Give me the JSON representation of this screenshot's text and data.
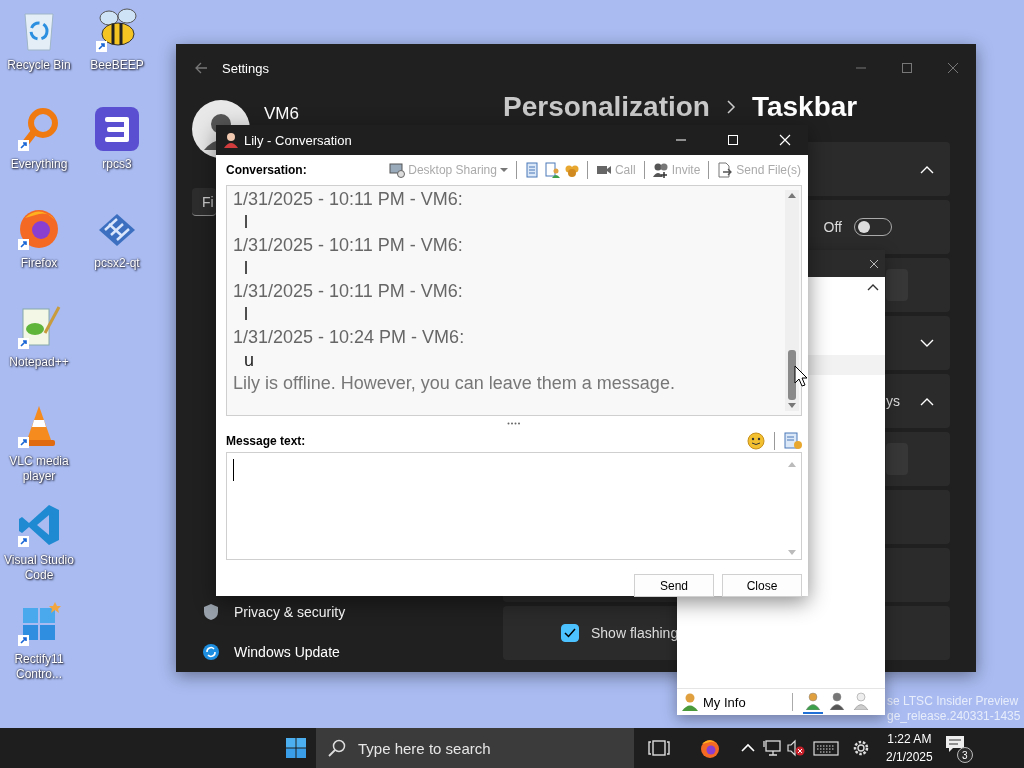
{
  "desktop_columns": [
    {
      "icons": [
        {
          "label": "Recycle Bin",
          "kind": "recycle",
          "shortcut": false
        },
        {
          "label": "Everything",
          "kind": "everything",
          "shortcut": true
        },
        {
          "label": "Firefox",
          "kind": "firefox",
          "shortcut": true
        },
        {
          "label": "Notepad++",
          "kind": "notepad",
          "shortcut": true
        },
        {
          "label": "VLC media player",
          "kind": "vlc",
          "shortcut": true
        },
        {
          "label": "Visual Studio Code",
          "kind": "vscode",
          "shortcut": true
        },
        {
          "label": "Rectify11 Contro...",
          "kind": "rectify",
          "shortcut": true
        }
      ]
    },
    {
      "icons": [
        {
          "label": "BeeBEEP",
          "kind": "bee",
          "shortcut": true
        },
        {
          "label": "rpcs3",
          "kind": "rpcs3",
          "shortcut": false
        },
        {
          "label": "pcsx2-qt",
          "kind": "pcsx2",
          "shortcut": false
        }
      ]
    }
  ],
  "settings": {
    "title": "Settings",
    "user": "VM6",
    "search_text": "Fi",
    "breadcrumb": [
      "Personalization",
      "Taskbar"
    ],
    "nav_items": [
      {
        "label": "Privacy & security",
        "kind": "shield"
      },
      {
        "label": "Windows Update",
        "kind": "update"
      }
    ],
    "cards": [
      {
        "kind": "expander",
        "expanded": true
      },
      {
        "kind": "toggle",
        "label": "Off",
        "on": false
      },
      {
        "kind": "dropdown"
      },
      {
        "kind": "expander",
        "expanded": false
      },
      {
        "kind": "expander",
        "expanded": true,
        "label": "ys"
      },
      {
        "kind": "dropdown"
      },
      {
        "kind": "plain"
      },
      {
        "kind": "plain"
      },
      {
        "kind": "checkbox",
        "checked": true,
        "label": "Show flashing"
      }
    ]
  },
  "contacts_window": {
    "expanded": true,
    "my_info": "My Info",
    "statuses": [
      {
        "kind": "online",
        "selected": true
      },
      {
        "kind": "busy",
        "selected": false
      },
      {
        "kind": "offline",
        "selected": false
      }
    ]
  },
  "build_info": [
    "se LTSC Insider Preview",
    "ge_release.240331-1435"
  ],
  "conversation": {
    "title": "Lily - Conversation",
    "label": "Conversation:",
    "tools": [
      {
        "kind": "desktop",
        "label": "Desktop Sharing",
        "dropdown": true,
        "disabled": true
      },
      {
        "kind": "notes",
        "separator_before": true,
        "disabled": false
      },
      {
        "kind": "info",
        "disabled": false
      },
      {
        "kind": "group",
        "disabled": false
      },
      {
        "kind": "call",
        "label": "Call",
        "separator_before": true,
        "disabled": true
      },
      {
        "kind": "invite",
        "label": "Invite",
        "separator_before": true,
        "disabled": true
      },
      {
        "kind": "file",
        "label": "Send File(s)",
        "separator_before": true,
        "disabled": true
      }
    ],
    "messages": [
      {
        "header": "1/31/2025 - 10:11 PM - VM6:",
        "text": "l"
      },
      {
        "header": "1/31/2025 - 10:11 PM - VM6:",
        "text": "l"
      },
      {
        "header": "1/31/2025 - 10:11 PM - VM6:",
        "text": "l"
      },
      {
        "header": "1/31/2025 - 10:24 PM - VM6:",
        "text": "u"
      }
    ],
    "notice": "Lily is offline. However, you can leave them a message.",
    "message_label": "Message text:",
    "buttons": [
      "Send",
      "Close"
    ]
  },
  "taskbar": {
    "search_placeholder": "Type here to search",
    "time": "1:22 AM",
    "date": "2/1/2025",
    "notifications": "3",
    "volume_muted": true
  }
}
